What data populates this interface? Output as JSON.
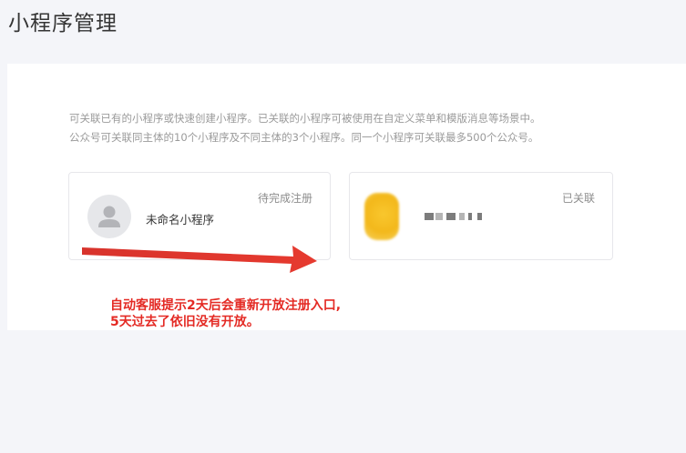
{
  "page": {
    "title": "小程序管理"
  },
  "description": {
    "line1": "可关联已有的小程序或快速创建小程序。已关联的小程序可被使用在自定义菜单和模版消息等场景中。",
    "line2": "公众号可关联同主体的10个小程序及不同主体的3个小程序。同一个小程序可关联最多500个公众号。"
  },
  "cards": [
    {
      "name": "未命名小程序",
      "status": "待完成注册",
      "icon": "user-placeholder-icon"
    },
    {
      "name": "",
      "status": "已关联",
      "icon": "blurred-logo-icon"
    }
  ],
  "annotation": {
    "line1": "自动客服提示2天后会重新开放注册入口,",
    "line2": "5天过去了依旧没有开放。",
    "color": "#e42a24"
  }
}
